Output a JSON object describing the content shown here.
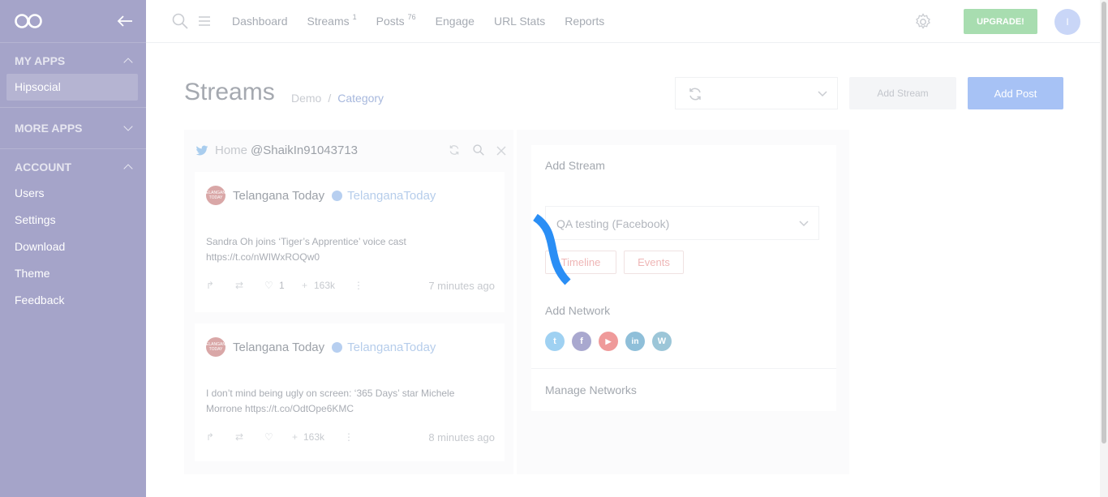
{
  "sidebar": {
    "sections": [
      {
        "title": "MY APPS",
        "items": [
          {
            "label": "Hipsocial"
          }
        ]
      },
      {
        "title": "MORE APPS",
        "items": []
      },
      {
        "title": "ACCOUNT",
        "items": [
          {
            "label": "Users"
          },
          {
            "label": "Settings"
          },
          {
            "label": "Download"
          },
          {
            "label": "Theme"
          },
          {
            "label": "Feedback"
          }
        ]
      }
    ]
  },
  "topnav": {
    "links": [
      {
        "label": "Dashboard",
        "badge": ""
      },
      {
        "label": "Streams",
        "badge": "1"
      },
      {
        "label": "Posts",
        "badge": "76"
      },
      {
        "label": "Engage",
        "badge": ""
      },
      {
        "label": "URL Stats",
        "badge": ""
      },
      {
        "label": "Reports",
        "badge": ""
      }
    ],
    "upgrade_label": "UPGRADE!",
    "avatar_initial": "I"
  },
  "header": {
    "title": "Streams",
    "breadcrumb": [
      "Demo",
      "Category"
    ],
    "add_stream_label": "Add Stream",
    "add_post_label": "Add Post"
  },
  "stream": {
    "tab": "Home",
    "handle": "@ShaikIn91043713",
    "tweets": [
      {
        "avatar_text": "TELANGANA TODAY",
        "name": "Telangana Today",
        "username": "TelanganaToday",
        "text": "Sandra Oh joins ‘Tiger’s Apprentice’ voice cast https://t.co/nWIWxROQw0",
        "likes": "1",
        "followers": "163k",
        "time": "7 minutes ago"
      },
      {
        "avatar_text": "TELANGANA TODAY",
        "name": "Telangana Today",
        "username": "TelanganaToday",
        "text": "I don’t mind being ugly on screen: ‘365 Days’ star Michele Morrone https://t.co/OdtOpe6KMC",
        "likes": "",
        "followers": "163k",
        "time": "8 minutes ago"
      }
    ]
  },
  "add_stream_panel": {
    "title": "Add Stream",
    "account_selected": "QA testing (Facebook)",
    "types": [
      "Timeline",
      "Events"
    ],
    "network_title": "Add Network",
    "networks": [
      {
        "name": "twitter-icon",
        "color": "#9fd1f2",
        "glyph": "t"
      },
      {
        "name": "facebook-icon",
        "color": "#a9a8cf",
        "glyph": "f"
      },
      {
        "name": "youtube-icon",
        "color": "#ef9a9a",
        "glyph": "▶"
      },
      {
        "name": "linkedin-icon",
        "color": "#8fbfd9",
        "glyph": "in"
      },
      {
        "name": "wordpress-icon",
        "color": "#9cc6d8",
        "glyph": "W"
      }
    ],
    "manage_label": "Manage Networks"
  }
}
